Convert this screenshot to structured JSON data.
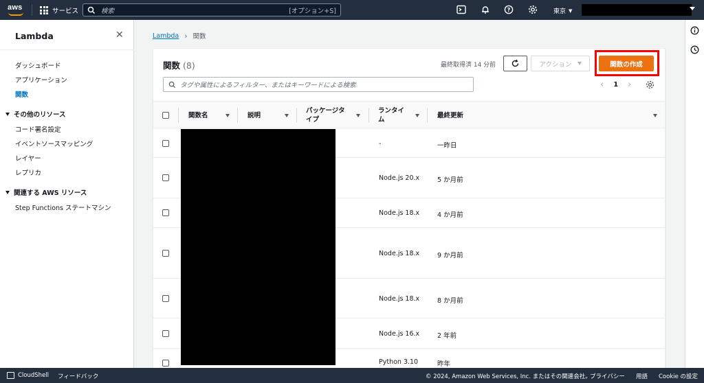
{
  "topbar": {
    "logo_text": "aws",
    "services_label": "サービス",
    "search_placeholder": "検索",
    "search_shortcut": "[オプション+S]",
    "region": "東京"
  },
  "sidebar": {
    "title": "Lambda",
    "items": [
      {
        "label": "ダッシュボード"
      },
      {
        "label": "アプリケーション"
      },
      {
        "label": "関数"
      }
    ],
    "section_other": "その他のリソース",
    "other_items": [
      {
        "label": "コード署名設定"
      },
      {
        "label": "イベントソースマッピング"
      },
      {
        "label": "レイヤー"
      },
      {
        "label": "レプリカ"
      }
    ],
    "section_related": "関連する AWS リソース",
    "related_items": [
      {
        "label": "Step Functions ステートマシン"
      }
    ]
  },
  "breadcrumb": {
    "parent": "Lambda",
    "current": "関数"
  },
  "panel": {
    "title": "関数",
    "count": "(8)",
    "last_fetched": "最終取得済 14 分前",
    "action_label": "アクション",
    "create_label": "関数の作成",
    "filter_placeholder": "タグや属性によるフィルター、またはキーワードによる検索",
    "page_number": "1"
  },
  "table": {
    "columns": {
      "name": "関数名",
      "description": "説明",
      "package_line1": "パッケージタ",
      "package_line2": "イプ",
      "runtime_line1": "ランタイ",
      "runtime_line2": "ム",
      "last_modified": "最終更新"
    },
    "rows": [
      {
        "runtime": "-",
        "last_modified": "一昨日"
      },
      {
        "runtime": "Node.js 20.x",
        "last_modified": "5 か月前"
      },
      {
        "runtime": "Node.js 18.x",
        "last_modified": "4 か月前"
      },
      {
        "runtime": "Node.js 18.x",
        "last_modified": "9 か月前"
      },
      {
        "runtime": "Node.js 18.x",
        "last_modified": "8 か月前"
      },
      {
        "runtime": "Node.js 16.x",
        "last_modified": "2 年前"
      },
      {
        "runtime": "Python 3.10",
        "last_modified": "昨年"
      }
    ]
  },
  "footer": {
    "cloudshell": "CloudShell",
    "feedback": "フィードバック",
    "copyright": "© 2024, Amazon Web Services, Inc. またはその関連会社。",
    "privacy": "プライバシー",
    "terms": "用語",
    "cookie": "Cookie の設定"
  },
  "colors": {
    "nav_bg": "#232f3e",
    "primary_orange": "#ec7211",
    "link_blue": "#0073bb",
    "highlight_red": "#ff0000"
  }
}
